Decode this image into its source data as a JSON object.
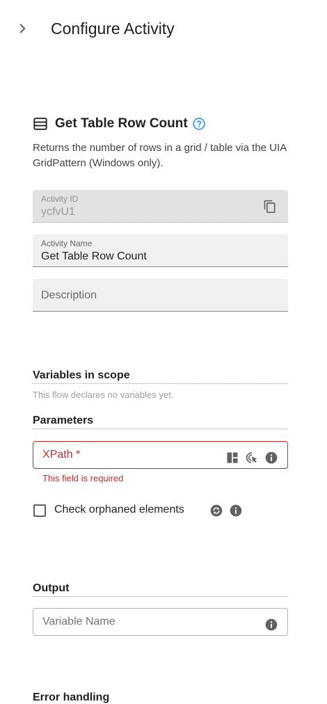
{
  "header": {
    "title": "Configure Activity"
  },
  "activity": {
    "title": "Get Table Row Count",
    "description": "Returns the number of rows in a grid / table via the UIA GridPattern (Windows only)."
  },
  "fields": {
    "activity_id": {
      "label": "Activity ID",
      "value": "ycfvU1"
    },
    "activity_name": {
      "label": "Activity Name",
      "value": "Get Table Row Count"
    },
    "description": {
      "placeholder": "Description"
    }
  },
  "variables": {
    "title": "Variables in scope",
    "note": "This flow declares no variables yet."
  },
  "parameters": {
    "title": "Parameters",
    "xpath": {
      "label": "XPath *",
      "error": "This field is required"
    },
    "check_orphaned": {
      "label": "Check orphaned elements",
      "checked": false
    }
  },
  "output": {
    "title": "Output",
    "variable_name": {
      "placeholder": "Variable Name"
    }
  },
  "next_section": {
    "title": "Error handling"
  },
  "colors": {
    "error": "#c62828",
    "help": "#1e88e5",
    "icon": "#616161"
  }
}
